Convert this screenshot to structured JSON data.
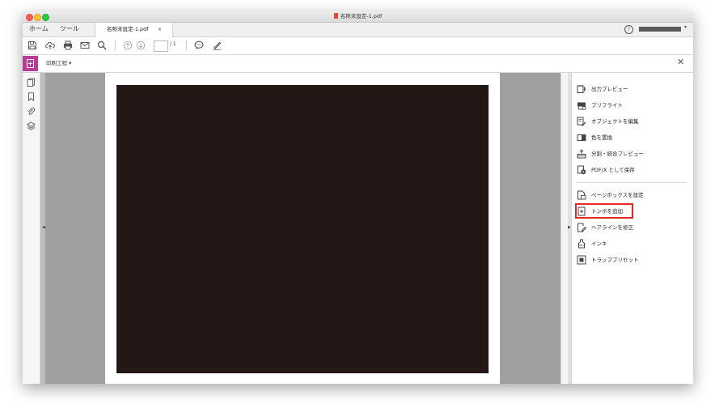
{
  "window": {
    "title": "名称未設定-1.pdf"
  },
  "tabs": {
    "home": "ホーム",
    "tools": "ツール",
    "document": "名称未設定-1.pdf",
    "close": "×"
  },
  "header": {
    "help": "?",
    "account_caret": "▾"
  },
  "toolbar": {
    "page_total": "/ 1"
  },
  "tool": {
    "name": "印刷工程 ▾",
    "close": "✕"
  },
  "right_panel": {
    "group1": [
      {
        "label": "出力プレビュー",
        "icon": "output-preview-icon"
      },
      {
        "label": "プリフライト",
        "icon": "preflight-icon"
      },
      {
        "label": "オブジェクトを編集",
        "icon": "edit-object-icon"
      },
      {
        "label": "色を置換",
        "icon": "replace-color-icon"
      },
      {
        "label": "分割・統合プレビュー",
        "icon": "flattener-preview-icon"
      },
      {
        "label": "PDF/X として保存",
        "icon": "save-pdfx-icon"
      }
    ],
    "group2": [
      {
        "label": "ページボックスを設定",
        "icon": "page-box-icon"
      },
      {
        "label": "トンボを追加",
        "icon": "add-printer-marks-icon",
        "highlighted": true
      },
      {
        "label": "ヘアラインを修正",
        "icon": "fix-hairlines-icon"
      },
      {
        "label": "インキ",
        "icon": "ink-icon"
      },
      {
        "label": "トラッププリセット",
        "icon": "trap-presets-icon"
      }
    ]
  },
  "colors": {
    "tool_accent": "#b83c9a",
    "highlight_border": "#e8271f",
    "artwork_fill": "#231815",
    "canvas_gray": "#a0a0a0"
  }
}
